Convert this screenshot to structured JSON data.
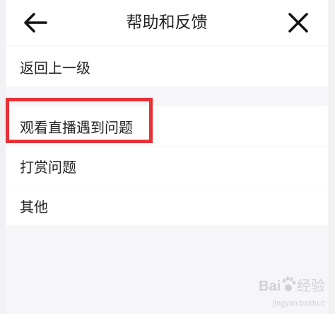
{
  "header": {
    "title": "帮助和反馈",
    "back_icon": "arrow-left-icon",
    "close_icon": "close-icon"
  },
  "menu": {
    "items": [
      {
        "label": "返回上一级"
      },
      {
        "label": "观看直播遇到问题"
      },
      {
        "label": "打赏问题"
      },
      {
        "label": "其他"
      }
    ]
  },
  "highlight": {
    "color": "#e63136",
    "target": "观看直播遇到问题"
  },
  "watermark": {
    "brand": "Baidu 经验",
    "url": "jingyan.baidu.com"
  }
}
